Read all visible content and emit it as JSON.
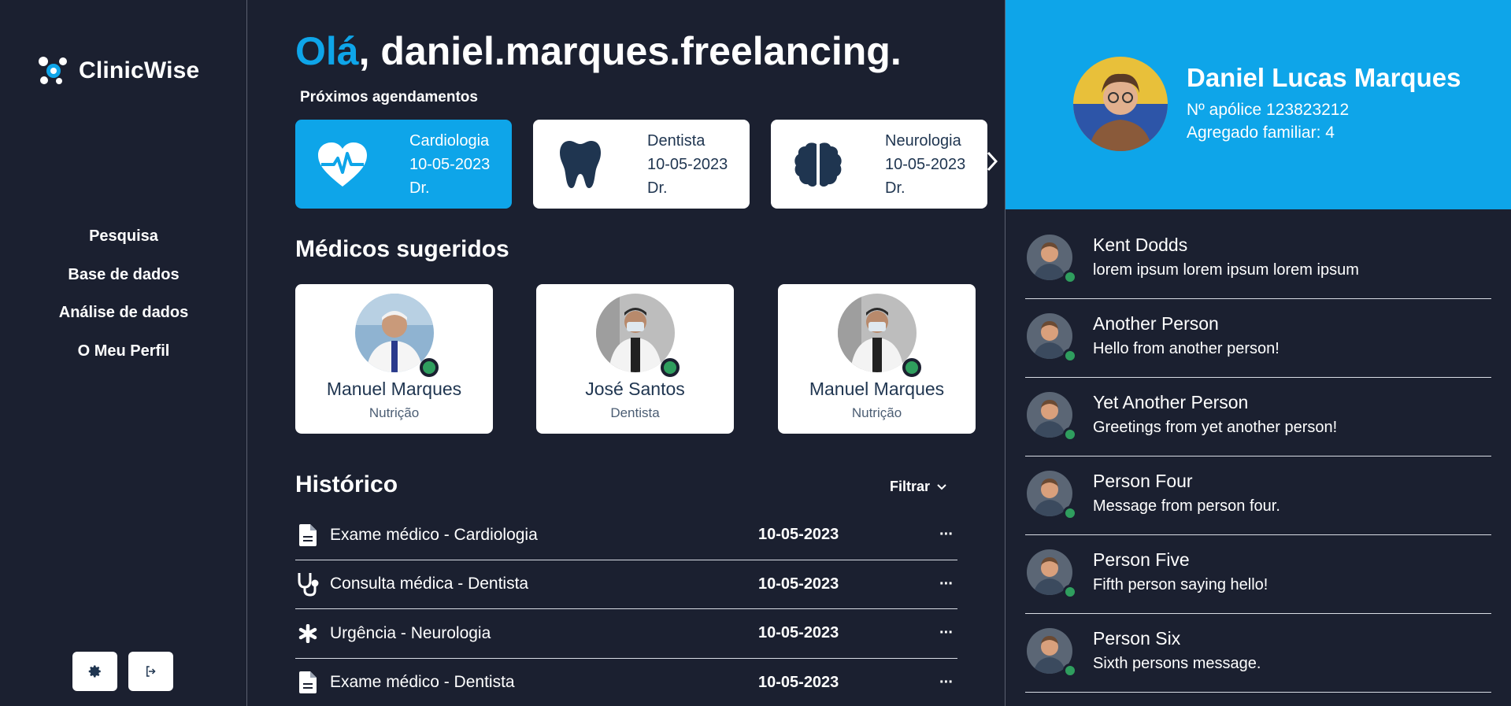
{
  "app": {
    "logo_text": "ClinicWise"
  },
  "nav": {
    "items": [
      "Pesquisa",
      "Base de dados",
      "Análise de dados",
      "O Meu Perfil"
    ]
  },
  "greeting": {
    "hello": "Olá",
    "rest": ", daniel.marques.freelancing."
  },
  "appointments": {
    "title": "Próximos agendamentos",
    "items": [
      {
        "specialty": "Cardiologia",
        "date": "10-05-2023",
        "doctor": "Dr.",
        "icon": "heart-pulse-icon"
      },
      {
        "specialty": "Dentista",
        "date": "10-05-2023",
        "doctor": "Dr.",
        "icon": "tooth-icon"
      },
      {
        "specialty": "Neurologia",
        "date": "10-05-2023",
        "doctor": "Dr.",
        "icon": "brain-icon"
      }
    ]
  },
  "suggested": {
    "title": "Médicos sugeridos",
    "doctors": [
      {
        "name": "Manuel Marques",
        "specialty": "Nutrição"
      },
      {
        "name": "José Santos",
        "specialty": "Dentista"
      },
      {
        "name": "Manuel Marques",
        "specialty": "Nutrição"
      }
    ]
  },
  "history": {
    "title": "Histórico",
    "filter_label": "Filtrar",
    "rows": [
      {
        "title": "Exame médico - Cardiologia",
        "date": "10-05-2023",
        "icon": "document-icon"
      },
      {
        "title": "Consulta médica - Dentista",
        "date": "10-05-2023",
        "icon": "stethoscope-icon"
      },
      {
        "title": "Urgência - Neurologia",
        "date": "10-05-2023",
        "icon": "asterisk-icon"
      },
      {
        "title": "Exame médico - Dentista",
        "date": "10-05-2023",
        "icon": "document-icon"
      }
    ],
    "more_label": "···"
  },
  "profile": {
    "name": "Daniel Lucas Marques",
    "policy": "Nº apólice 123823212",
    "household": "Agregado familiar: 4"
  },
  "contacts": [
    {
      "name": "Kent Dodds",
      "message": "lorem ipsum lorem ipsum lorem ipsum"
    },
    {
      "name": "Another Person",
      "message": "Hello from another person!"
    },
    {
      "name": "Yet Another Person",
      "message": "Greetings from yet another person!"
    },
    {
      "name": "Person Four",
      "message": "Message from person four."
    },
    {
      "name": "Person Five",
      "message": "Fifth person saying hello!"
    },
    {
      "name": "Person Six",
      "message": "Sixth persons message."
    }
  ],
  "colors": {
    "accent": "#0ea5e9",
    "background": "#1b2030",
    "online": "#2f9e5e",
    "card_text": "#1f3550"
  }
}
